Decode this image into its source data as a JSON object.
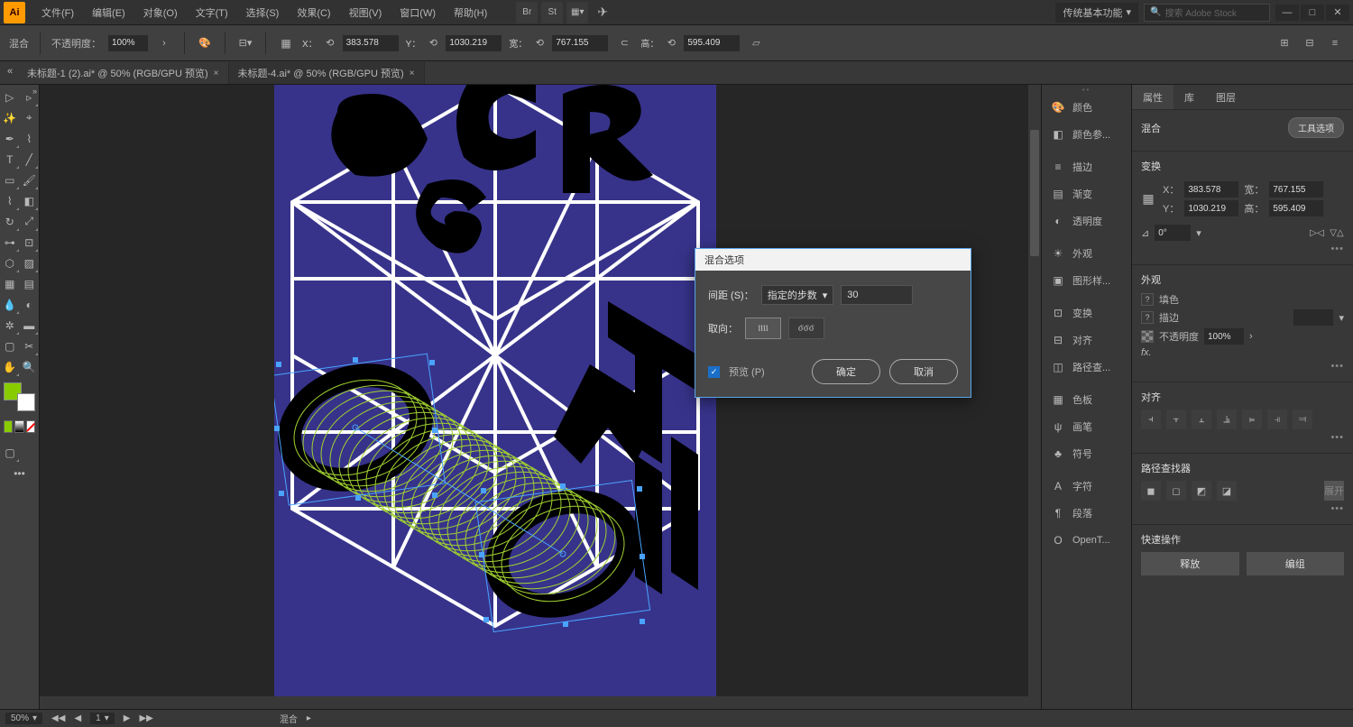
{
  "app": {
    "icon": "Ai"
  },
  "menu": [
    "文件(F)",
    "编辑(E)",
    "对象(O)",
    "文字(T)",
    "选择(S)",
    "效果(C)",
    "视图(V)",
    "窗口(W)",
    "帮助(H)"
  ],
  "workspace": "传统基本功能",
  "search_placeholder": "搜索 Adobe Stock",
  "controlbar": {
    "mode": "混合",
    "opacity_label": "不透明度：",
    "opacity_value": "100%",
    "x_label": "X：",
    "x": "383.578",
    "y_label": "Y：",
    "y": "1030.219",
    "w_label": "宽：",
    "w": "767.155",
    "h_label": "高：",
    "h": "595.409"
  },
  "tabs": [
    {
      "title": "未标题-1 (2).ai* @ 50% (RGB/GPU 预览)",
      "active": false
    },
    {
      "title": "未标题-4.ai* @ 50% (RGB/GPU 预览)",
      "active": true
    }
  ],
  "dock_items": [
    [
      "palette-icon",
      "颜色"
    ],
    [
      "swatches-icon",
      "颜色参..."
    ],
    [
      "",
      " "
    ],
    [
      "stroke-icon",
      "描边"
    ],
    [
      "gradient-icon",
      "渐变"
    ],
    [
      "transparency-icon",
      "透明度"
    ],
    [
      "",
      " "
    ],
    [
      "appearance-icon",
      "外观"
    ],
    [
      "graphic-styles-icon",
      "图形样..."
    ],
    [
      "",
      " "
    ],
    [
      "transform-icon",
      "变换"
    ],
    [
      "align-icon",
      "对齐"
    ],
    [
      "pathfinder-icon",
      "路径查..."
    ],
    [
      "",
      " "
    ],
    [
      "swatches2-icon",
      "色板"
    ],
    [
      "brushes-icon",
      "画笔"
    ],
    [
      "symbols-icon",
      "符号"
    ],
    [
      "",
      " "
    ],
    [
      "char-icon",
      "字符"
    ],
    [
      "para-icon",
      "段落"
    ],
    [
      "opentype-icon",
      "OpenT..."
    ]
  ],
  "props": {
    "tabs": [
      "属性",
      "库",
      "图层"
    ],
    "selection": "混合",
    "tool_options_btn": "工具选项",
    "transform": {
      "title": "变换",
      "x_label": "X：",
      "x": "383.578",
      "y_label": "Y：",
      "y": "1030.219",
      "w_label": "宽：",
      "w": "767.155",
      "h_label": "高：",
      "h": "595.409",
      "angle_label": "⊿",
      "angle": "0°"
    },
    "appearance": {
      "title": "外观",
      "fill": "填色",
      "stroke": "描边",
      "opacity_label": "不透明度",
      "opacity": "100%",
      "fx": "fx."
    },
    "align": {
      "title": "对齐"
    },
    "pathfinder": {
      "title": "路径查找器"
    },
    "quick": {
      "title": "快速操作",
      "release": "释放",
      "group": "编组"
    }
  },
  "dialog": {
    "title": "混合选项",
    "spacing_label": "间距 (S)：",
    "spacing_mode": "指定的步数",
    "spacing_value": "30",
    "orientation_label": "取向：",
    "preview": "预览 (P)",
    "ok": "确定",
    "cancel": "取消"
  },
  "status": {
    "zoom": "50%",
    "artboard_nav": "1",
    "tool": "混合"
  }
}
